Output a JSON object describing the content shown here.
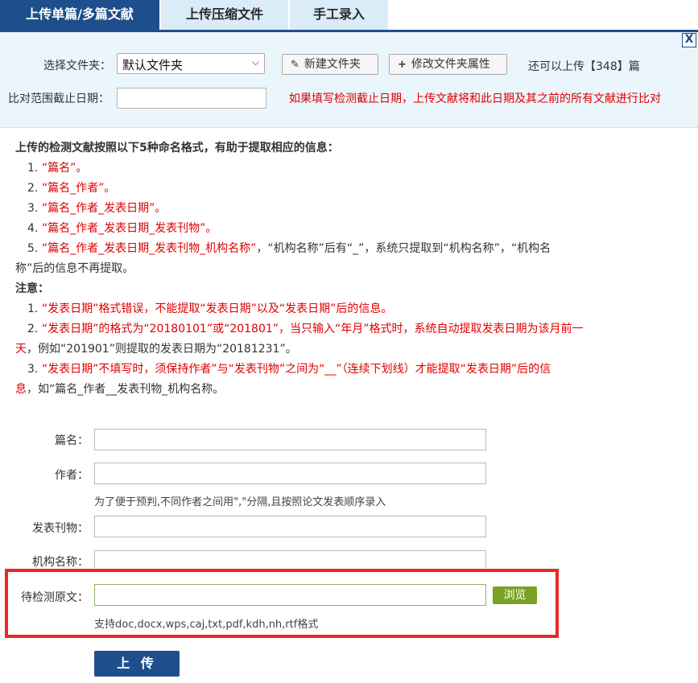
{
  "tabs": [
    {
      "label": "上传单篇/多篇文献"
    },
    {
      "label": "上传压缩文件"
    },
    {
      "label": "手工录入"
    }
  ],
  "panel": {
    "close_label": "X",
    "folder_label": "选择文件夹：",
    "folder_value": "默认文件夹",
    "new_folder_label": "新建文件夹",
    "edit_folder_label": "修改文件夹属性",
    "remaining_text": "还可以上传【348】篇",
    "date_label": "比对范围截止日期：",
    "date_value": "",
    "date_hint": "如果填写检测截止日期，上传文献将和此日期及其之前的所有文献进行比对"
  },
  "info": {
    "heading": "上传的检测文献按照以下5种命名格式，有助于提取相应的信息：",
    "formats": [
      {
        "num": "1.",
        "red": "“篇名”。",
        "rest": ""
      },
      {
        "num": "2.",
        "red": "“篇名_作者”。",
        "rest": ""
      },
      {
        "num": "3.",
        "red": "“篇名_作者_发表日期”。",
        "rest": ""
      },
      {
        "num": "4.",
        "red": "“篇名_作者_发表日期_发表刊物”。",
        "rest": ""
      },
      {
        "num": "5.",
        "red": "“篇名_作者_发表日期_发表刊物_机构名称”",
        "rest": "，“机构名称”后有“_”，系统只提取到“机构名称”，“机构名",
        "rest2": "称”后的信息不再提取。"
      }
    ],
    "notes_heading": "注意：",
    "notes": [
      {
        "num": "1.",
        "red": "“发表日期”格式错误，不能提取“发表日期”以及“发表日期”后的信息。"
      },
      {
        "num": "2.",
        "red": "“发表日期”的格式为“20180101”或“201801”，当只输入“年月”格式时，系统自动提取发表日期为该月前一",
        "red2": "天",
        "rest2": "，例如“201901”则提取的发表日期为“20181231”。"
      },
      {
        "num": "3.",
        "red": "“发表日期”不填写时，须保持作者”与“发表刊物”之间为“__”（连续下划线）才能提取“发表日期”后的信",
        "red2": "息",
        "rest2": "，如“篇名_作者__发表刊物_机构名称。"
      }
    ]
  },
  "form": {
    "title_label": "篇名：",
    "title_value": "",
    "author_label": "作者：",
    "author_value": "",
    "author_hint": "为了便于预判,不同作者之间用\",\"分隔,且按照论文发表顺序录入",
    "journal_label": "发表刊物：",
    "journal_value": "",
    "org_label": "机构名称：",
    "org_value": "",
    "file_label": "待检测原文：",
    "file_value": "",
    "browse_label": "浏览",
    "file_hint": "支持doc,docx,wps,caj,txt,pdf,kdh,nh,rtf格式",
    "upload_label": "上 传"
  },
  "colors": {
    "primary": "#1e4f8c",
    "tab_inactive": "#d9ecf8",
    "panel_bg": "#eaf5fc",
    "warning_red": "#e00000",
    "highlight": "#e8292a",
    "browse_green": "#7aa223"
  }
}
